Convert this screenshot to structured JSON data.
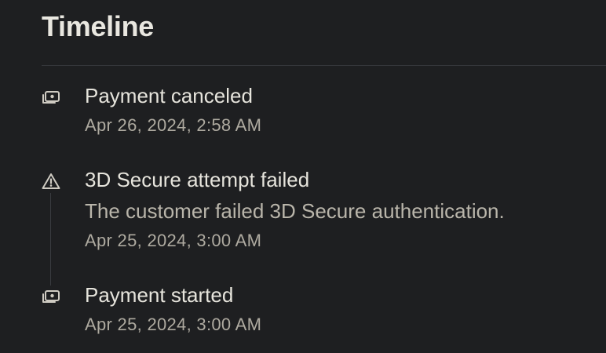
{
  "timeline": {
    "title": "Timeline",
    "events": [
      {
        "icon": "payment-icon",
        "title": "Payment canceled",
        "time": "Apr 26, 2024, 2:58 AM"
      },
      {
        "icon": "warning-icon",
        "title": "3D Secure attempt failed",
        "description": "The customer failed 3D Secure authentication.",
        "time": "Apr 25, 2024, 3:00 AM"
      },
      {
        "icon": "payment-icon",
        "title": "Payment started",
        "time": "Apr 25, 2024, 3:00 AM"
      }
    ]
  },
  "colors": {
    "background": "#1e1f21",
    "primary_text": "#e6e4dc",
    "secondary_text": "#b9b5aa",
    "divider": "#34363a"
  }
}
